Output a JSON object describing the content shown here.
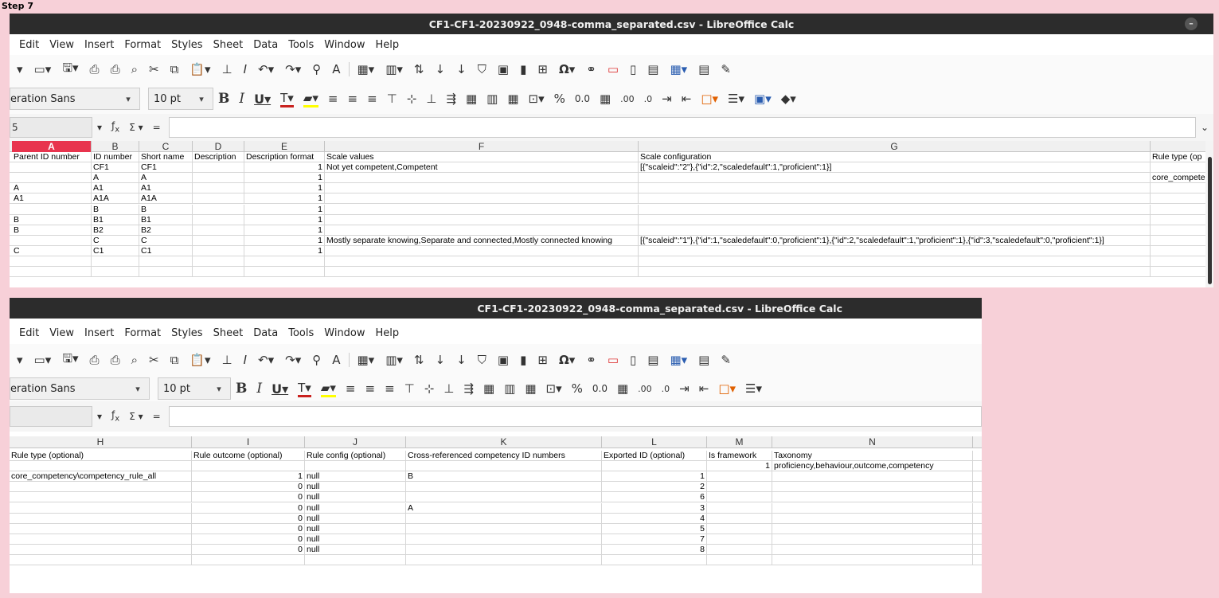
{
  "step_label": "Step 7",
  "window1": {
    "title": "CF1-CF1-20230922_0948-comma_separated.csv - LibreOffice Calc",
    "menu": [
      "Edit",
      "View",
      "Insert",
      "Format",
      "Styles",
      "Sheet",
      "Data",
      "Tools",
      "Window",
      "Help"
    ],
    "font_name": "eration Sans",
    "font_size": "10 pt",
    "name_box": "5",
    "columns": [
      "A",
      "B",
      "C",
      "D",
      "E",
      "F",
      "G",
      ""
    ],
    "selected_column": "A",
    "rows": [
      [
        "Parent ID number",
        "ID number",
        "Short name",
        "Description",
        "Description format",
        "Scale values",
        "Scale configuration",
        "Rule type (op"
      ],
      [
        "",
        "CF1",
        "CF1",
        "",
        "1",
        "Not yet competent,Competent",
        "[{\"scaleid\":\"2\"},{\"id\":2,\"scaledefault\":1,\"proficient\":1}]",
        ""
      ],
      [
        "",
        "A",
        "A",
        "",
        "1",
        "",
        "",
        "core_compete"
      ],
      [
        "A",
        "A1",
        "A1",
        "",
        "1",
        "",
        "",
        ""
      ],
      [
        "A1",
        "A1A",
        "A1A",
        "",
        "1",
        "",
        "",
        ""
      ],
      [
        "",
        "B",
        "B",
        "",
        "1",
        "",
        "",
        ""
      ],
      [
        "B",
        "B1",
        "B1",
        "",
        "1",
        "",
        "",
        ""
      ],
      [
        "B",
        "B2",
        "B2",
        "",
        "1",
        "",
        "",
        ""
      ],
      [
        "",
        "C",
        "C",
        "",
        "1",
        "Mostly separate knowing,Separate and connected,Mostly connected knowing",
        "[{\"scaleid\":\"1\"},{\"id\":1,\"scaledefault\":0,\"proficient\":1},{\"id\":2,\"scaledefault\":1,\"proficient\":1},{\"id\":3,\"scaledefault\":0,\"proficient\":1}]",
        ""
      ],
      [
        "C",
        "C1",
        "C1",
        "",
        "1",
        "",
        "",
        ""
      ],
      [
        "",
        "",
        "",
        "",
        "",
        "",
        "",
        ""
      ],
      [
        "",
        "",
        "",
        "",
        "",
        "",
        "",
        ""
      ]
    ]
  },
  "window2": {
    "title": "CF1-CF1-20230922_0948-comma_separated.csv - LibreOffice Calc",
    "menu": [
      "Edit",
      "View",
      "Insert",
      "Format",
      "Styles",
      "Sheet",
      "Data",
      "Tools",
      "Window",
      "Help"
    ],
    "font_name": "eration Sans",
    "font_size": "10 pt",
    "name_box": "",
    "columns": [
      "H",
      "I",
      "J",
      "K",
      "L",
      "M",
      "N",
      ""
    ],
    "rows": [
      [
        "Rule type (optional)",
        "Rule outcome (optional)",
        "Rule config (optional)",
        "Cross-referenced competency ID numbers",
        "Exported ID (optional)",
        "Is framework",
        "Taxonomy",
        ""
      ],
      [
        "",
        "",
        "",
        "",
        "",
        "1",
        "proficiency,behaviour,outcome,competency",
        ""
      ],
      [
        "core_competency\\competency_rule_all",
        "1",
        "null",
        "B",
        "1",
        "",
        "",
        ""
      ],
      [
        "",
        "0",
        "null",
        "",
        "2",
        "",
        "",
        ""
      ],
      [
        "",
        "0",
        "null",
        "",
        "6",
        "",
        "",
        ""
      ],
      [
        "",
        "0",
        "null",
        "A",
        "3",
        "",
        "",
        ""
      ],
      [
        "",
        "0",
        "null",
        "",
        "4",
        "",
        "",
        ""
      ],
      [
        "",
        "0",
        "null",
        "",
        "5",
        "",
        "",
        ""
      ],
      [
        "",
        "0",
        "null",
        "",
        "7",
        "",
        "",
        ""
      ],
      [
        "",
        "0",
        "null",
        "",
        "8",
        "",
        "",
        ""
      ],
      [
        "",
        "",
        "",
        "",
        "",
        "",
        "",
        ""
      ]
    ]
  }
}
